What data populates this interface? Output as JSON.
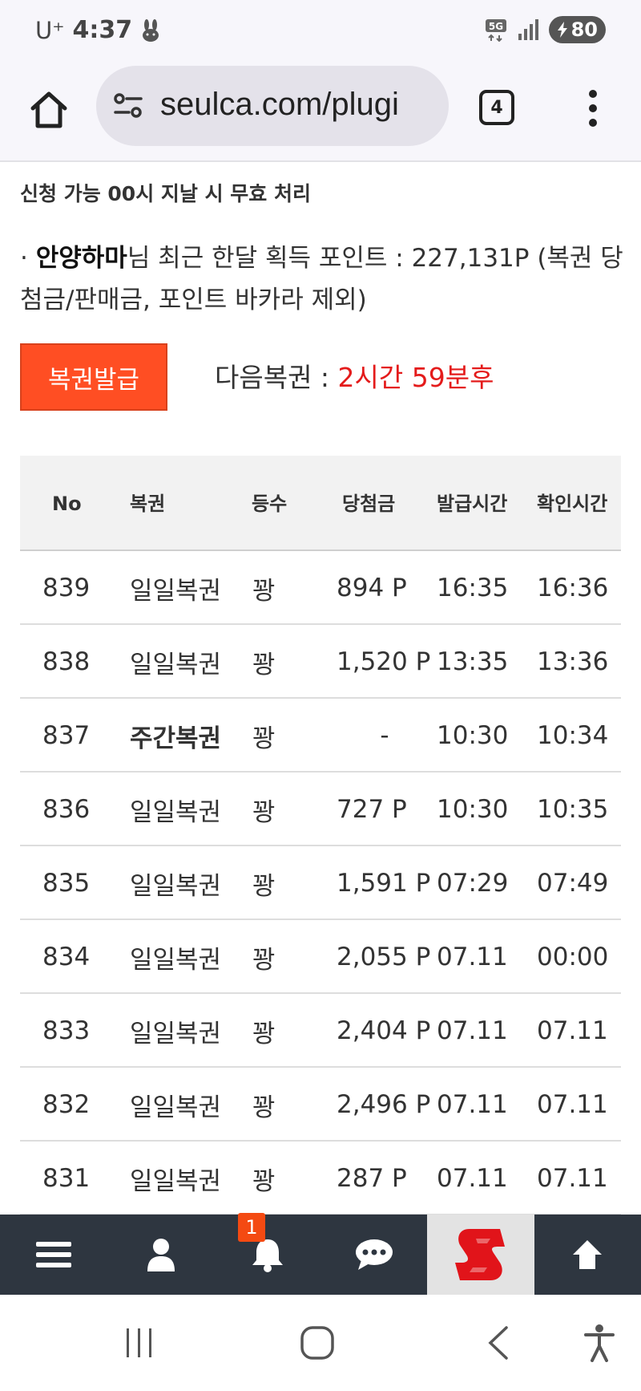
{
  "status_bar": {
    "carrier": "U⁺",
    "time": "4:37",
    "network": "5G",
    "battery": "80"
  },
  "browser": {
    "url": "seulca.com/plugi",
    "tab_count": "4"
  },
  "notice": "신청 가능 00시 지날 시 무효 처리",
  "points": {
    "bullet": "·",
    "user": "안양하마",
    "text": "님 최근 한달 획득 포인트 : 227,131P (복권 당첨금/판매금, 포인트 바카라 제외)"
  },
  "issue_button": "복권발급",
  "next_lottery": {
    "label": "다음복권 : ",
    "value": "2시간 59분후"
  },
  "table": {
    "headers": {
      "no": "No",
      "type": "복권",
      "rank": "등수",
      "prize": "당첨금",
      "issue_time": "발급시간",
      "check_time": "확인시간"
    },
    "rows": [
      {
        "no": "839",
        "type": "일일복권",
        "rank": "꽝",
        "prize": "894 P",
        "issue": "16:35",
        "check": "16:36"
      },
      {
        "no": "838",
        "type": "일일복권",
        "rank": "꽝",
        "prize": "1,520 P",
        "issue": "13:35",
        "check": "13:36"
      },
      {
        "no": "837",
        "type": "주간복권",
        "rank": "꽝",
        "prize": "-",
        "issue": "10:30",
        "check": "10:34"
      },
      {
        "no": "836",
        "type": "일일복권",
        "rank": "꽝",
        "prize": "727 P",
        "issue": "10:30",
        "check": "10:35"
      },
      {
        "no": "835",
        "type": "일일복권",
        "rank": "꽝",
        "prize": "1,591 P",
        "issue": "07:29",
        "check": "07:49"
      },
      {
        "no": "834",
        "type": "일일복권",
        "rank": "꽝",
        "prize": "2,055 P",
        "issue": "07.11",
        "check": "00:00"
      },
      {
        "no": "833",
        "type": "일일복권",
        "rank": "꽝",
        "prize": "2,404 P",
        "issue": "07.11",
        "check": "07.11"
      },
      {
        "no": "832",
        "type": "일일복권",
        "rank": "꽝",
        "prize": "2,496 P",
        "issue": "07.11",
        "check": "07.11"
      },
      {
        "no": "831",
        "type": "일일복권",
        "rank": "꽝",
        "prize": "287 P",
        "issue": "07.11",
        "check": "07.11"
      }
    ]
  },
  "bottom_bar": {
    "notification_count": "1",
    "icons": [
      "menu-icon",
      "user-icon",
      "bell-icon",
      "chat-icon",
      "site-logo-icon",
      "arrow-up-icon"
    ]
  },
  "colors": {
    "accent": "#ff4e23",
    "countdown": "#e41b1b",
    "toolbar": "#2e3640"
  }
}
